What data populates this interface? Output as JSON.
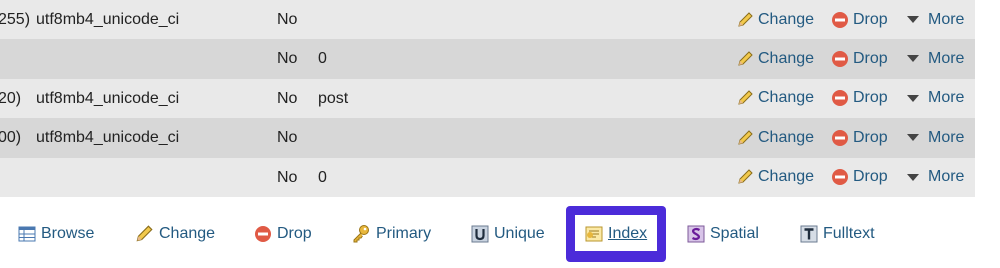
{
  "rows": [
    {
      "length": "255)",
      "collation": "utf8mb4_unicode_ci",
      "null": "No",
      "default": ""
    },
    {
      "length": "",
      "collation": "",
      "null": "No",
      "default": "0"
    },
    {
      "length": "20)",
      "collation": "utf8mb4_unicode_ci",
      "null": "No",
      "default": "post"
    },
    {
      "length": "00)",
      "collation": "utf8mb4_unicode_ci",
      "null": "No",
      "default": ""
    },
    {
      "length": "",
      "collation": "",
      "null": "No",
      "default": "0"
    }
  ],
  "row_actions": {
    "change": "Change",
    "drop": "Drop",
    "more": "More"
  },
  "toolbar": {
    "browse": "Browse",
    "change": "Change",
    "drop": "Drop",
    "primary": "Primary",
    "unique": "Unique",
    "index": "Index",
    "spatial": "Spatial",
    "fulltext": "Fulltext"
  },
  "icons": {
    "browse": "table-icon",
    "change": "pencil-icon",
    "drop": "minus-circle-icon",
    "primary": "key-icon",
    "unique": "unique-icon",
    "index": "index-icon",
    "spatial": "spatial-icon",
    "fulltext": "fulltext-icon",
    "more": "triangle-down-icon"
  },
  "colors": {
    "link": "#235a81",
    "highlight": "#4b2bd9",
    "row_odd": "#e9e9e9",
    "row_even": "#d7d7d7"
  }
}
